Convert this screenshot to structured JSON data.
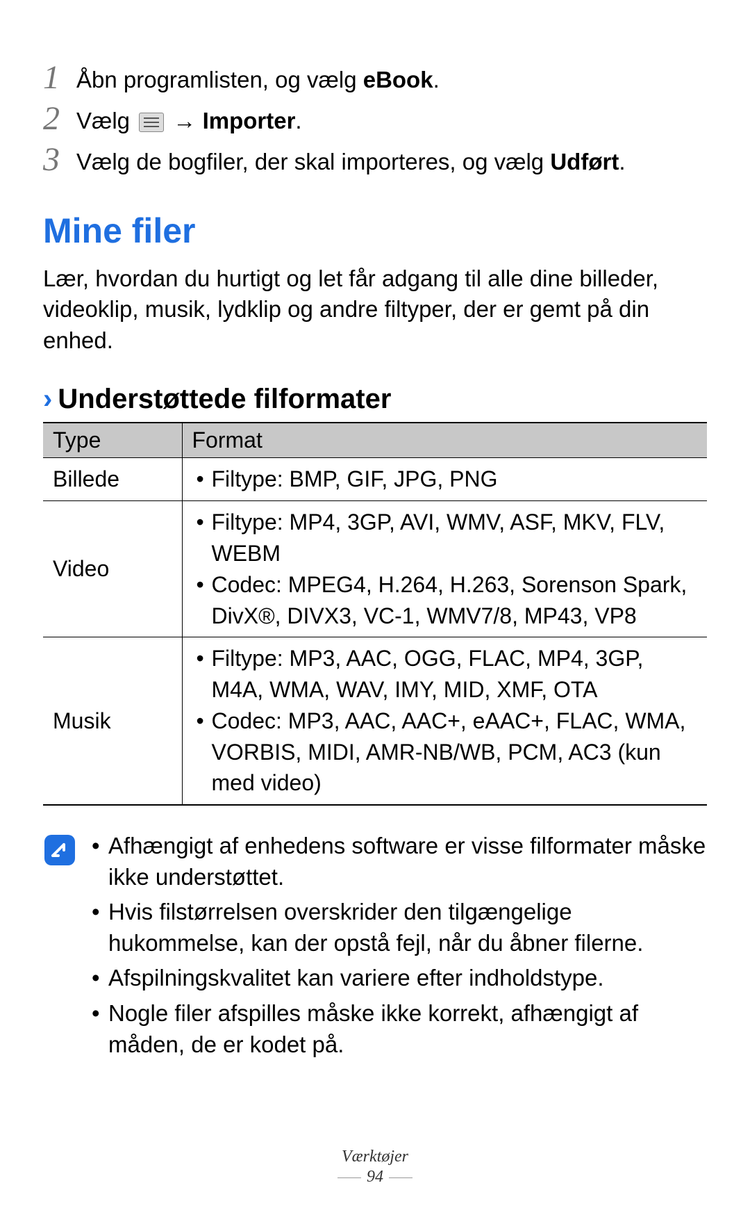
{
  "steps": [
    {
      "num": "1",
      "pre": "Åbn programlisten, og vælg ",
      "bold": "eBook",
      "post": "."
    },
    {
      "num": "2",
      "pre": "Vælg ",
      "icon": true,
      "arrow": " → ",
      "bold": "Importer",
      "post": "."
    },
    {
      "num": "3",
      "pre": "Vælg de bogfiler, der skal importeres, og vælg ",
      "bold": "Udført",
      "post": "."
    }
  ],
  "section": {
    "heading": "Mine filer",
    "body": "Lær, hvordan du hurtigt og let får adgang til alle dine billeder, videoklip, musik, lydklip og andre filtyper, der er gemt på din enhed."
  },
  "sub": {
    "chevron": "›",
    "title": "Understøttede filformater"
  },
  "table": {
    "head": {
      "col1": "Type",
      "col2": "Format"
    },
    "rows": [
      {
        "type": "Billede",
        "items": [
          "Filtype: BMP, GIF, JPG, PNG"
        ]
      },
      {
        "type": "Video",
        "items": [
          "Filtype: MP4, 3GP, AVI, WMV, ASF, MKV, FLV, WEBM",
          "Codec: MPEG4, H.264, H.263, Sorenson Spark, DivX®, DIVX3, VC-1, WMV7/8, MP43, VP8"
        ]
      },
      {
        "type": "Musik",
        "items": [
          "Filtype: MP3, AAC, OGG, FLAC, MP4, 3GP, M4A, WMA, WAV, IMY, MID, XMF, OTA",
          "Codec: MP3, AAC, AAC+, eAAC+, FLAC, WMA, VORBIS, MIDI, AMR-NB/WB, PCM, AC3 (kun med video)"
        ]
      }
    ]
  },
  "notes": [
    "Afhængigt af enhedens software er visse filformater måske ikke understøttet.",
    "Hvis filstørrelsen overskrider den tilgængelige hukommelse, kan der opstå fejl, når du åbner filerne.",
    "Afspilningskvalitet kan variere efter indholdstype.",
    "Nogle filer afspilles måske ikke korrekt, afhængigt af måden, de er kodet på."
  ],
  "footer": {
    "category": "Værktøjer",
    "page": "94"
  }
}
